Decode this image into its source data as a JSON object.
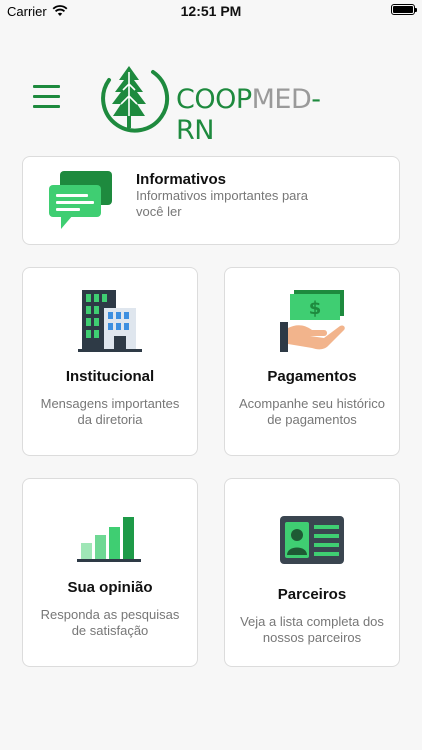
{
  "status_bar": {
    "carrier": "Carrier",
    "time": "12:51 PM",
    "wifi_icon": "wifi-icon",
    "battery_icon": "battery-icon"
  },
  "header": {
    "menu_icon": "hamburger-menu-icon",
    "logo": {
      "part1": "COOP",
      "part2": "MED",
      "part3": "-RN",
      "brand_color": "#1e8a3e",
      "secondary_color": "#9a9a9a"
    }
  },
  "cards": {
    "informativos": {
      "title": "Informativos",
      "description": "Informativos importantes para você ler",
      "icon": "chat-bubbles-icon"
    },
    "institucional": {
      "title": "Institucional",
      "description": "Mensagens importantes da diretoria",
      "icon": "building-icon"
    },
    "pagamentos": {
      "title": "Pagamentos",
      "description": "Acompanhe seu histórico de pagamentos",
      "icon": "money-hand-icon"
    },
    "sua_opiniao": {
      "title": "Sua opinião",
      "description": "Responda as pesquisas de satisfação",
      "icon": "bar-chart-icon"
    },
    "parceiros": {
      "title": "Parceiros",
      "description": "Veja a lista completa dos nossos parceiros",
      "icon": "id-card-icon"
    }
  }
}
